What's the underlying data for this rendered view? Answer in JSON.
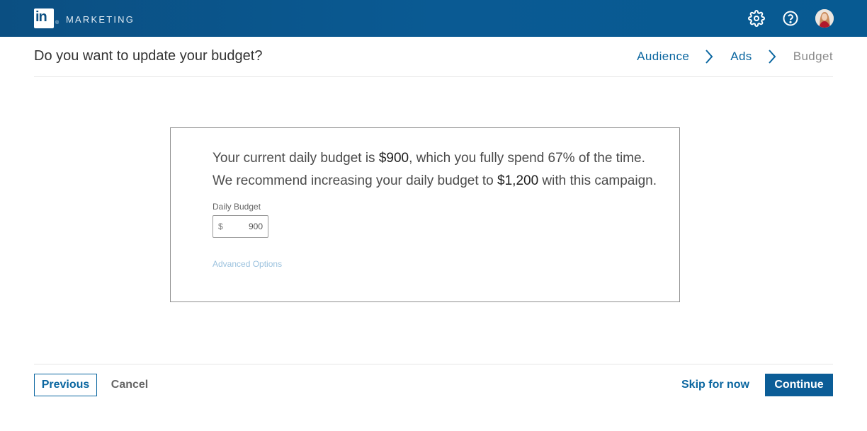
{
  "topbar": {
    "logo_text": "in",
    "logo_reg": "®",
    "brand": "MARKETING",
    "icons": [
      "settings-gear-icon",
      "help-question-icon"
    ],
    "background_color": "#0b4f82"
  },
  "header": {
    "title": "Do you want to update your budget?",
    "breadcrumb": {
      "audience": "Audience",
      "ads": "Ads",
      "budget": "Budget"
    }
  },
  "card": {
    "line1": {
      "prefix": "Your current daily budget is ",
      "current_budget": "$900",
      "suffix": ", which you fully spend 67% of the time."
    },
    "line2": {
      "prefix": "We recommend increasing your daily budget to ",
      "recommended_budget": "$1,200",
      "suffix": " with this campaign."
    },
    "daily_budget_label": "Daily Budget",
    "currency_symbol": "$",
    "daily_budget_value": "900",
    "advanced_options": "Advanced Options"
  },
  "footer": {
    "previous": "Previous",
    "cancel": "Cancel",
    "skip": "Skip for now",
    "continue": "Continue"
  },
  "colors": {
    "accent": "#0a66a0",
    "primary_button": "#0b5d97",
    "link_muted": "#9cc2de"
  }
}
